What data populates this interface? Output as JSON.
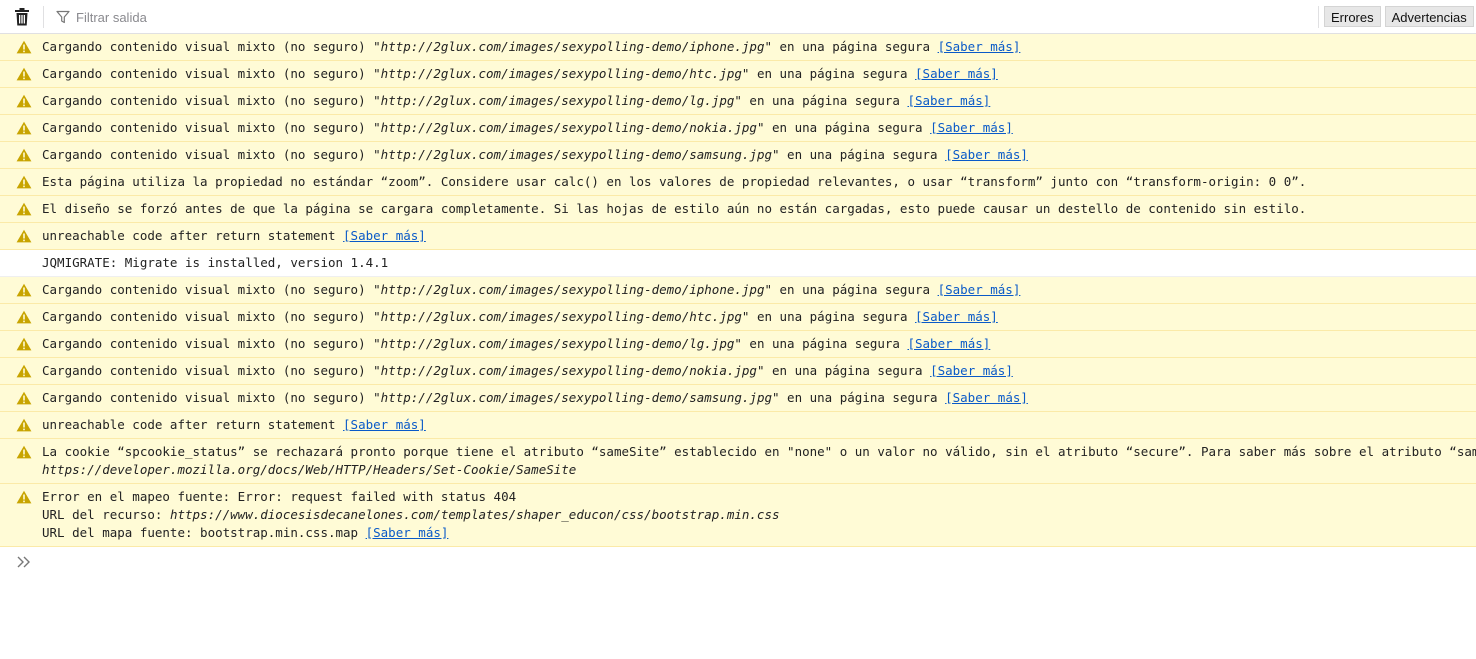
{
  "toolbar": {
    "clear_icon": "trash-icon",
    "filter_icon": "funnel-icon",
    "filter_placeholder": "Filtrar salida",
    "filter_value": "",
    "level_buttons": [
      "Errores",
      "Advertencias"
    ]
  },
  "colors": {
    "warning_bg": "#fffbd6",
    "warning_icon": "#c8a400",
    "link": "#0a5ac8"
  },
  "learn_more": "[Saber más]",
  "messages": [
    {
      "type": "warning",
      "pre": "Cargando contenido visual mixto (no seguro) ",
      "url": "\"http://2glux.com/images/sexypolling-demo/iphone.jpg\"",
      "post": " en una página segura "
    },
    {
      "type": "warning",
      "pre": "Cargando contenido visual mixto (no seguro) ",
      "url": "\"http://2glux.com/images/sexypolling-demo/htc.jpg\"",
      "post": " en una página segura "
    },
    {
      "type": "warning",
      "pre": "Cargando contenido visual mixto (no seguro) ",
      "url": "\"http://2glux.com/images/sexypolling-demo/lg.jpg\"",
      "post": " en una página segura "
    },
    {
      "type": "warning",
      "pre": "Cargando contenido visual mixto (no seguro) ",
      "url": "\"http://2glux.com/images/sexypolling-demo/nokia.jpg\"",
      "post": " en una página segura "
    },
    {
      "type": "warning",
      "pre": "Cargando contenido visual mixto (no seguro) ",
      "url": "\"http://2glux.com/images/sexypolling-demo/samsung.jpg\"",
      "post": " en una página segura "
    },
    {
      "type": "warning",
      "text": "Esta página utiliza la propiedad no estándar “zoom”. Considere usar calc() en los valores de propiedad relevantes, o usar “transform” junto con “transform-origin: 0 0”."
    },
    {
      "type": "warning",
      "text": "El diseño se forzó antes de que la página se cargara completamente. Si las hojas de estilo aún no están cargadas, esto puede causar un destello de contenido sin estilo."
    },
    {
      "type": "warning",
      "pre": "unreachable code after return statement "
    },
    {
      "type": "log",
      "text": "JQMIGRATE: Migrate is installed, version 1.4.1"
    },
    {
      "type": "warning",
      "pre": "Cargando contenido visual mixto (no seguro) ",
      "url": "\"http://2glux.com/images/sexypolling-demo/iphone.jpg\"",
      "post": " en una página segura "
    },
    {
      "type": "warning",
      "pre": "Cargando contenido visual mixto (no seguro) ",
      "url": "\"http://2glux.com/images/sexypolling-demo/htc.jpg\"",
      "post": " en una página segura "
    },
    {
      "type": "warning",
      "pre": "Cargando contenido visual mixto (no seguro) ",
      "url": "\"http://2glux.com/images/sexypolling-demo/lg.jpg\"",
      "post": " en una página segura "
    },
    {
      "type": "warning",
      "pre": "Cargando contenido visual mixto (no seguro) ",
      "url": "\"http://2glux.com/images/sexypolling-demo/nokia.jpg\"",
      "post": " en una página segura "
    },
    {
      "type": "warning",
      "pre": "Cargando contenido visual mixto (no seguro) ",
      "url": "\"http://2glux.com/images/sexypolling-demo/samsung.jpg\"",
      "post": " en una página segura "
    },
    {
      "type": "warning",
      "pre": "unreachable code after return statement "
    }
  ],
  "cookie_message": {
    "line1": "La cookie “spcookie_status” se rechazará pronto porque tiene el atributo “sameSite” establecido en \"none\" o un valor no válido, sin el atributo “secure”. Para saber más sobre el atributo “sameSite”, lea",
    "line2": "https://developer.mozilla.org/docs/Web/HTTP/Headers/Set-Cookie/SameSite"
  },
  "sourcemap_message": {
    "line1": "Error en el mapeo fuente: Error: request failed with status 404",
    "line2_label": "URL del recurso: ",
    "line2_url": "https://www.diocesisdecanelones.com/templates/shaper_educon/css/bootstrap.min.css",
    "line3": "URL del mapa fuente: bootstrap.min.css.map "
  },
  "console_input": {
    "prompt_icon": "double-chevron-right-icon",
    "value": ""
  }
}
